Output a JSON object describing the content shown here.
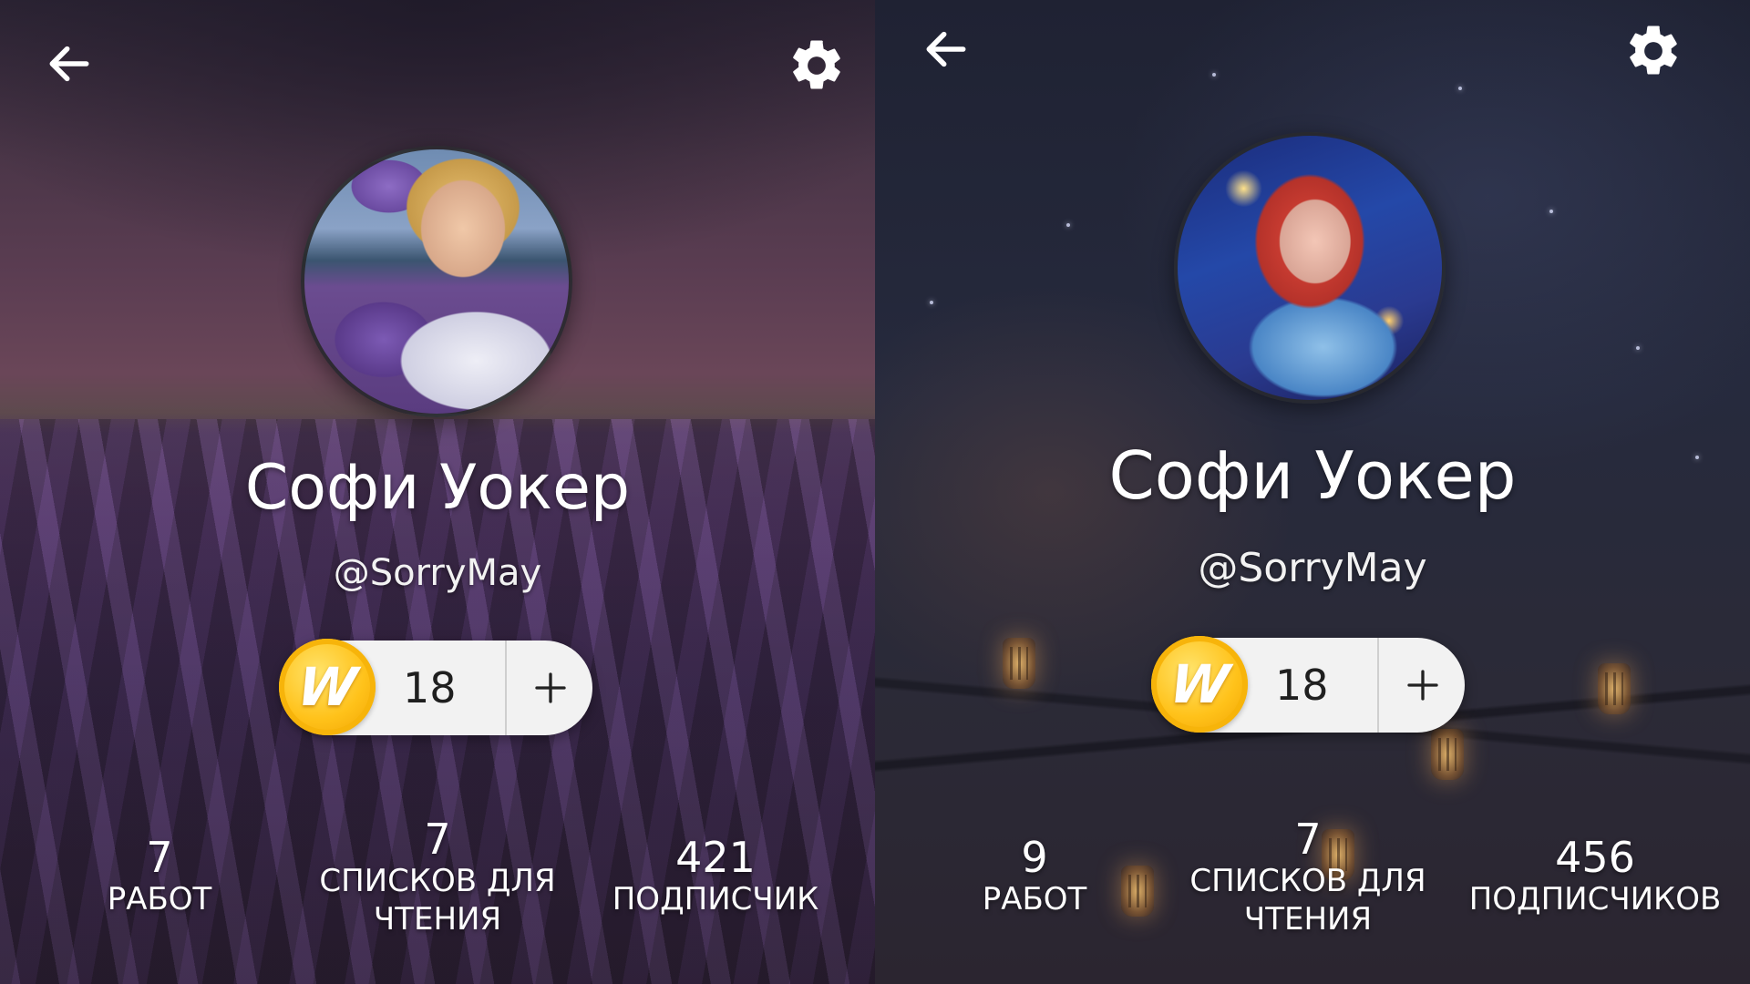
{
  "left_profile": {
    "name": "Софи Уокер",
    "username": "@SorryMay",
    "coins": "18",
    "coin_symbol": "W",
    "stats": [
      {
        "value": "7",
        "label": "РАБОТ"
      },
      {
        "value": "7",
        "label": "СПИСКОВ ДЛЯ ЧТЕНИЯ"
      },
      {
        "value": "421",
        "label": "ПОДПИСЧИК"
      }
    ]
  },
  "right_profile": {
    "name": "Софи Уокер",
    "username": "@SorryMay",
    "coins": "18",
    "coin_symbol": "W",
    "stats": [
      {
        "value": "9",
        "label": "РАБОТ"
      },
      {
        "value": "7",
        "label": "СПИСКОВ ДЛЯ ЧТЕНИЯ"
      },
      {
        "value": "456",
        "label": "ПОДПИСЧИКОВ"
      }
    ]
  },
  "icons": {
    "back": "arrow-left-icon",
    "settings": "gear-icon",
    "add": "plus-icon",
    "coin": "wattpad-coin-icon"
  },
  "colors": {
    "text": "#ffffff",
    "pill_bg": "#f2f2f2",
    "coin_gold": "#ffc21a",
    "left_theme": "#4a3258",
    "right_theme": "#262a3d"
  }
}
